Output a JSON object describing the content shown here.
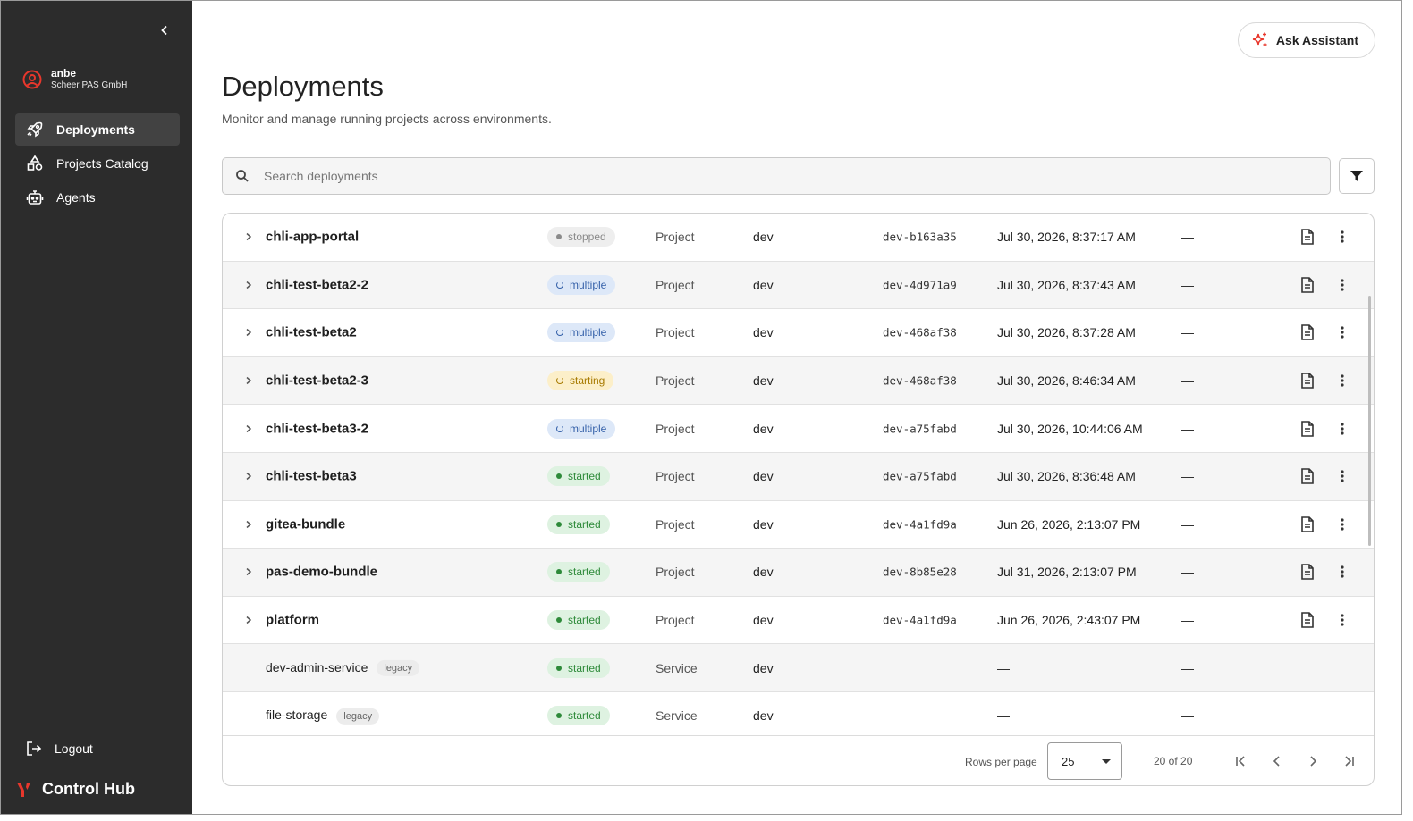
{
  "sidebar": {
    "user": {
      "name": "anbe",
      "org": "Scheer PAS GmbH"
    },
    "nav": [
      {
        "label": "Deployments",
        "icon": "rocket-icon",
        "active": true
      },
      {
        "label": "Projects Catalog",
        "icon": "shapes-icon",
        "active": false
      },
      {
        "label": "Agents",
        "icon": "robot-icon",
        "active": false
      }
    ],
    "logout_label": "Logout",
    "brand_label": "Control Hub"
  },
  "header": {
    "title": "Deployments",
    "subtitle": "Monitor and manage running projects across environments.",
    "ask_label": "Ask Assistant"
  },
  "search": {
    "placeholder": "Search deployments",
    "value": ""
  },
  "table": {
    "rows": [
      {
        "name": "chli-app-portal",
        "legacy": "",
        "status": "stopped",
        "type": "Project",
        "env": "dev",
        "version": "dev-b163a35",
        "date": "Jul 30, 2026, 8:37:17 AM",
        "extra": "—",
        "expandable": true
      },
      {
        "name": "chli-test-beta2-2",
        "legacy": "",
        "status": "multiple",
        "type": "Project",
        "env": "dev",
        "version": "dev-4d971a9",
        "date": "Jul 30, 2026, 8:37:43 AM",
        "extra": "—",
        "expandable": true
      },
      {
        "name": "chli-test-beta2",
        "legacy": "",
        "status": "multiple",
        "type": "Project",
        "env": "dev",
        "version": "dev-468af38",
        "date": "Jul 30, 2026, 8:37:28 AM",
        "extra": "—",
        "expandable": true
      },
      {
        "name": "chli-test-beta2-3",
        "legacy": "",
        "status": "starting",
        "type": "Project",
        "env": "dev",
        "version": "dev-468af38",
        "date": "Jul 30, 2026, 8:46:34 AM",
        "extra": "—",
        "expandable": true
      },
      {
        "name": "chli-test-beta3-2",
        "legacy": "",
        "status": "multiple",
        "type": "Project",
        "env": "dev",
        "version": "dev-a75fabd",
        "date": "Jul 30, 2026, 10:44:06 AM",
        "extra": "—",
        "expandable": true
      },
      {
        "name": "chli-test-beta3",
        "legacy": "",
        "status": "started",
        "type": "Project",
        "env": "dev",
        "version": "dev-a75fabd",
        "date": "Jul 30, 2026, 8:36:48 AM",
        "extra": "—",
        "expandable": true
      },
      {
        "name": "gitea-bundle",
        "legacy": "",
        "status": "started",
        "type": "Project",
        "env": "dev",
        "version": "dev-4a1fd9a",
        "date": "Jun 26, 2026, 2:13:07 PM",
        "extra": "—",
        "expandable": true
      },
      {
        "name": "pas-demo-bundle",
        "legacy": "",
        "status": "started",
        "type": "Project",
        "env": "dev",
        "version": "dev-8b85e28",
        "date": "Jul 31, 2026, 2:13:07 PM",
        "extra": "—",
        "expandable": true
      },
      {
        "name": "platform",
        "legacy": "",
        "status": "started",
        "type": "Project",
        "env": "dev",
        "version": "dev-4a1fd9a",
        "date": "Jun 26, 2026, 2:43:07 PM",
        "extra": "—",
        "expandable": true
      },
      {
        "name": "dev-admin-service",
        "legacy": "legacy",
        "status": "started",
        "type": "Service",
        "env": "dev",
        "version": "",
        "date": "—",
        "extra": "—",
        "expandable": false
      },
      {
        "name": "file-storage",
        "legacy": "legacy",
        "status": "started",
        "type": "Service",
        "env": "dev",
        "version": "",
        "date": "—",
        "extra": "—",
        "expandable": false
      }
    ]
  },
  "pagination": {
    "rows_per_page_label": "Rows per page",
    "rows_per_page_value": "25",
    "range_text": "20 of 20"
  },
  "colors": {
    "sidebar_bg": "#2c2c2c",
    "brand_red": "#e8372c",
    "ask_icon": "#e8372c"
  }
}
